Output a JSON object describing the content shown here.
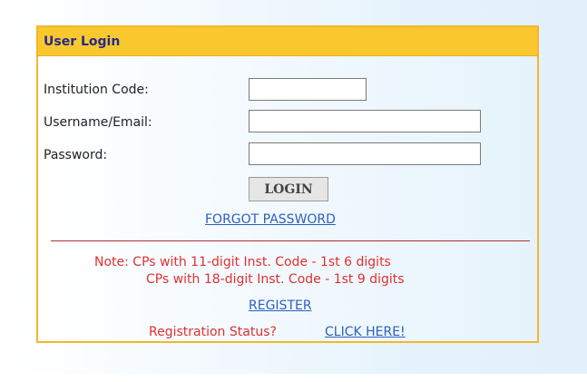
{
  "login": {
    "title": "User Login",
    "institution_code_label": "Institution Code:",
    "username_label": "Username/Email:",
    "password_label": "Password:",
    "institution_code_value": "",
    "username_value": "",
    "password_value": "",
    "login_button": "LOGIN",
    "forgot_password": "FORGOT PASSWORD",
    "note_line1": "Note: CPs with 11-digit Inst. Code - 1st 6 digits",
    "note_line2": "CPs with 18-digit Inst. Code - 1st 9 digits",
    "register_link": "REGISTER",
    "registration_status_label": "Registration Status?",
    "click_here_link": "CLICK HERE!"
  },
  "colors": {
    "header_bg": "#f9c82e",
    "header_text": "#262a8a",
    "border": "#f2b72a",
    "link": "#2b5fbf",
    "note": "#e03030",
    "divider": "#b03030"
  }
}
